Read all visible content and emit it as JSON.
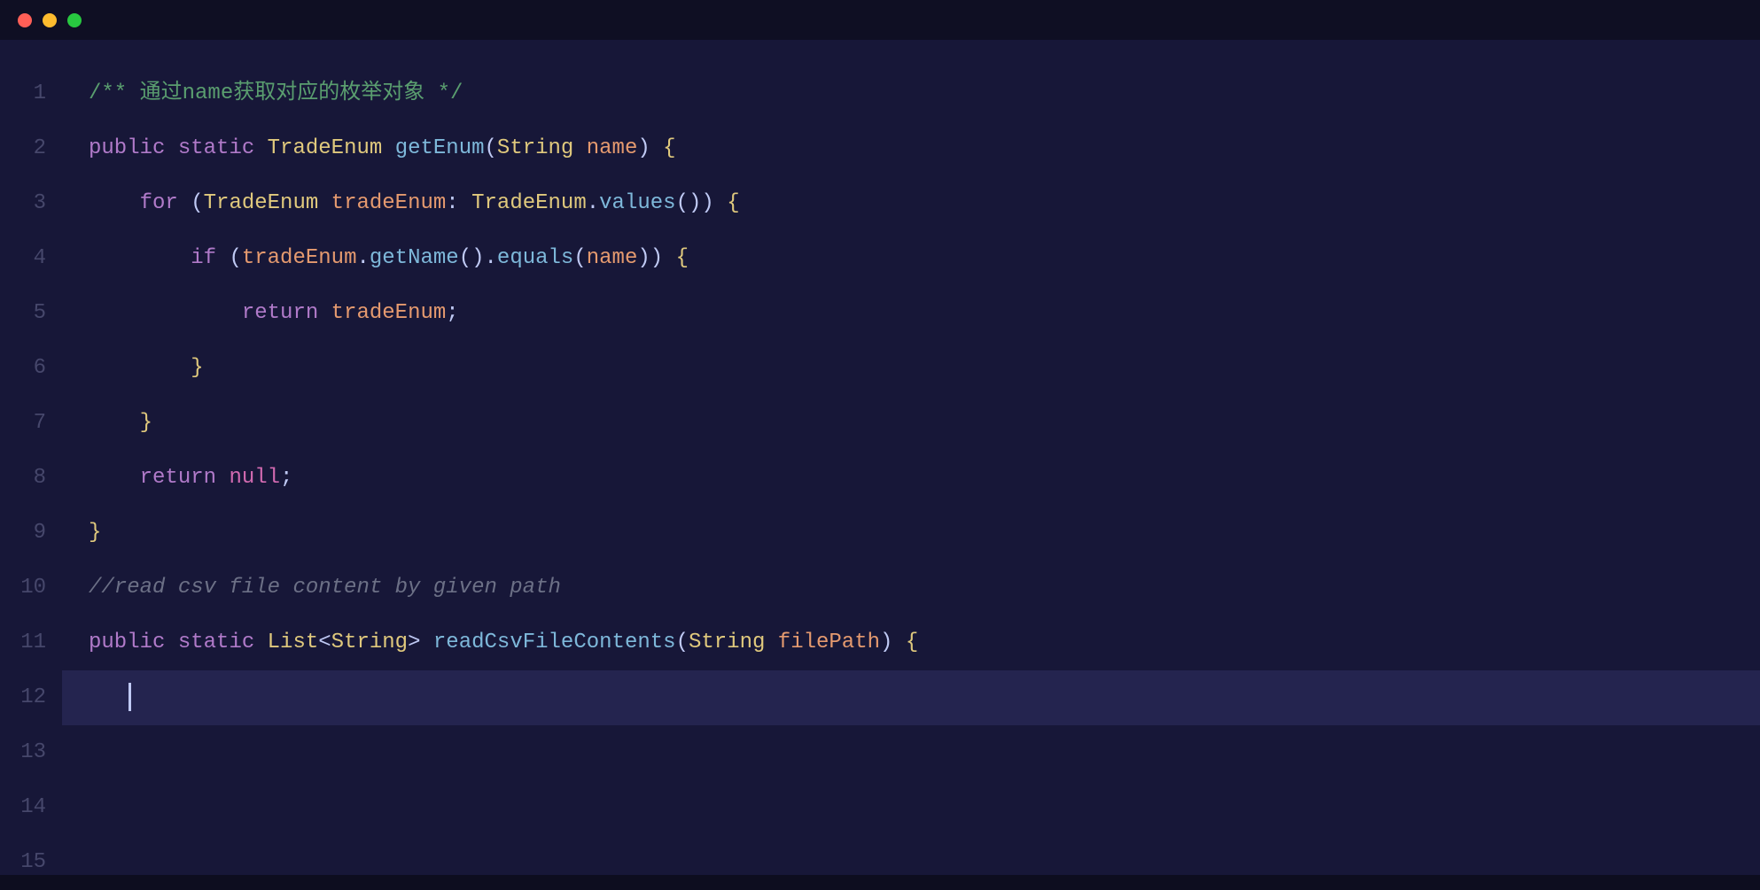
{
  "titlebar": {
    "buttons": [
      "close",
      "minimize",
      "maximize"
    ]
  },
  "editor": {
    "current_line": 12,
    "lines": [
      {
        "num": "1",
        "tokens": [
          {
            "cls": "tok-comment",
            "text": "/** 通过name获取对应的枚举对象 */"
          }
        ]
      },
      {
        "num": "2",
        "tokens": [
          {
            "cls": "tok-keyword",
            "text": "public"
          },
          {
            "cls": "",
            "text": " "
          },
          {
            "cls": "tok-keyword",
            "text": "static"
          },
          {
            "cls": "",
            "text": " "
          },
          {
            "cls": "tok-type",
            "text": "TradeEnum"
          },
          {
            "cls": "",
            "text": " "
          },
          {
            "cls": "tok-method",
            "text": "getEnum"
          },
          {
            "cls": "tok-punct",
            "text": "("
          },
          {
            "cls": "tok-type",
            "text": "String"
          },
          {
            "cls": "",
            "text": " "
          },
          {
            "cls": "tok-param",
            "text": "name"
          },
          {
            "cls": "tok-punct",
            "text": ")"
          },
          {
            "cls": "",
            "text": " "
          },
          {
            "cls": "tok-brace",
            "text": "{"
          }
        ]
      },
      {
        "num": "3",
        "tokens": [
          {
            "cls": "",
            "text": "    "
          },
          {
            "cls": "tok-keyword",
            "text": "for"
          },
          {
            "cls": "",
            "text": " "
          },
          {
            "cls": "tok-punct",
            "text": "("
          },
          {
            "cls": "tok-type",
            "text": "TradeEnum"
          },
          {
            "cls": "",
            "text": " "
          },
          {
            "cls": "tok-param",
            "text": "tradeEnum"
          },
          {
            "cls": "tok-punct",
            "text": ": "
          },
          {
            "cls": "tok-type",
            "text": "TradeEnum"
          },
          {
            "cls": "tok-dot",
            "text": "."
          },
          {
            "cls": "tok-method",
            "text": "values"
          },
          {
            "cls": "tok-punct",
            "text": "())"
          },
          {
            "cls": "",
            "text": " "
          },
          {
            "cls": "tok-brace",
            "text": "{"
          }
        ]
      },
      {
        "num": "4",
        "tokens": [
          {
            "cls": "",
            "text": "        "
          },
          {
            "cls": "tok-keyword",
            "text": "if"
          },
          {
            "cls": "",
            "text": " "
          },
          {
            "cls": "tok-punct",
            "text": "("
          },
          {
            "cls": "tok-param",
            "text": "tradeEnum"
          },
          {
            "cls": "tok-dot",
            "text": "."
          },
          {
            "cls": "tok-method",
            "text": "getName"
          },
          {
            "cls": "tok-punct",
            "text": "()"
          },
          {
            "cls": "tok-dot",
            "text": "."
          },
          {
            "cls": "tok-method",
            "text": "equals"
          },
          {
            "cls": "tok-punct",
            "text": "("
          },
          {
            "cls": "tok-param",
            "text": "name"
          },
          {
            "cls": "tok-punct",
            "text": "))"
          },
          {
            "cls": "",
            "text": " "
          },
          {
            "cls": "tok-brace",
            "text": "{"
          }
        ]
      },
      {
        "num": "5",
        "tokens": [
          {
            "cls": "",
            "text": "            "
          },
          {
            "cls": "tok-keyword",
            "text": "return"
          },
          {
            "cls": "",
            "text": " "
          },
          {
            "cls": "tok-param",
            "text": "tradeEnum"
          },
          {
            "cls": "tok-punct",
            "text": ";"
          }
        ]
      },
      {
        "num": "6",
        "tokens": [
          {
            "cls": "",
            "text": "        "
          },
          {
            "cls": "tok-brace",
            "text": "}"
          }
        ]
      },
      {
        "num": "7",
        "tokens": [
          {
            "cls": "",
            "text": "    "
          },
          {
            "cls": "tok-brace",
            "text": "}"
          }
        ]
      },
      {
        "num": "8",
        "tokens": [
          {
            "cls": "",
            "text": "    "
          },
          {
            "cls": "tok-keyword",
            "text": "return"
          },
          {
            "cls": "",
            "text": " "
          },
          {
            "cls": "tok-void",
            "text": "null"
          },
          {
            "cls": "tok-punct",
            "text": ";"
          }
        ]
      },
      {
        "num": "9",
        "tokens": [
          {
            "cls": "tok-brace",
            "text": "}"
          }
        ]
      },
      {
        "num": "10",
        "tokens": [
          {
            "cls": "tok-comment-gray",
            "text": "//read csv file content by given path"
          }
        ]
      },
      {
        "num": "11",
        "tokens": [
          {
            "cls": "tok-keyword",
            "text": "public"
          },
          {
            "cls": "",
            "text": " "
          },
          {
            "cls": "tok-keyword",
            "text": "static"
          },
          {
            "cls": "",
            "text": " "
          },
          {
            "cls": "tok-type",
            "text": "List"
          },
          {
            "cls": "tok-punct",
            "text": "<"
          },
          {
            "cls": "tok-type",
            "text": "String"
          },
          {
            "cls": "tok-punct",
            "text": ">"
          },
          {
            "cls": "",
            "text": " "
          },
          {
            "cls": "tok-method",
            "text": "readCsvFileContents"
          },
          {
            "cls": "tok-punct",
            "text": "("
          },
          {
            "cls": "tok-type",
            "text": "String"
          },
          {
            "cls": "",
            "text": " "
          },
          {
            "cls": "tok-param",
            "text": "filePath"
          },
          {
            "cls": "tok-punct",
            "text": ")"
          },
          {
            "cls": "",
            "text": " "
          },
          {
            "cls": "tok-brace",
            "text": "{"
          }
        ]
      },
      {
        "num": "12",
        "highlighted": true,
        "tokens": [
          {
            "cls": "",
            "text": "   "
          }
        ],
        "cursor": true
      },
      {
        "num": "13",
        "tokens": []
      },
      {
        "num": "14",
        "tokens": []
      },
      {
        "num": "15",
        "tokens": []
      }
    ]
  }
}
